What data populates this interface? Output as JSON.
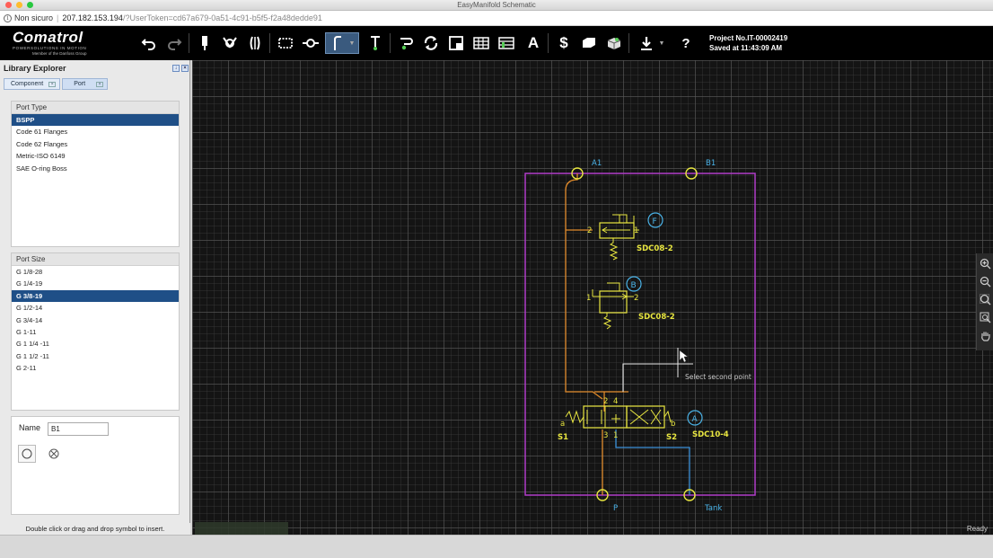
{
  "window": {
    "title": "EasyManifold Schematic"
  },
  "browser": {
    "security": "Non sicuro",
    "host": "207.182.153.194",
    "path": "/?UserToken=cd67a679-0a51-4c91-b5f5-f2a48dedde91"
  },
  "brand": {
    "name": "Comatrol",
    "tagline": "POWERSOLUTIONS IN MOTION",
    "subtitle": "Member of the Danfoss Group"
  },
  "project": {
    "number": "Project No.IT-00002419",
    "saved": "Saved at 11:43:09 AM"
  },
  "toolbar": {
    "text_tool": "A",
    "price_tool": "$",
    "help": "?"
  },
  "library": {
    "title": "Library Explorer",
    "tabs": [
      "Component",
      "Port"
    ],
    "port_type": {
      "header": "Port Type",
      "items": [
        "BSPP",
        "Code 61 Flanges",
        "Code 62 Flanges",
        "Metric-ISO 6149",
        "SAE O-ring Boss"
      ],
      "selected": "BSPP"
    },
    "port_size": {
      "header": "Port Size",
      "items": [
        "G 1/8-28",
        "G 1/4-19",
        "G 3/8-19",
        "G 1/2-14",
        "G 3/4-14",
        "G 1-11",
        "G 1 1/4 -11",
        "G 1 1/2 -11",
        "G 2-11"
      ],
      "selected": "G 3/8-19"
    },
    "name_label": "Name",
    "name_value": "B1",
    "status": "Double click or drag and drop symbol to insert."
  },
  "schematic": {
    "ports": {
      "a1": "A1",
      "b1": "B1",
      "p": "P",
      "tank": "Tank"
    },
    "valves": {
      "f": {
        "badge": "F",
        "model": "SDC08-2",
        "port_left": "2",
        "port_right": "1"
      },
      "b": {
        "badge": "B",
        "model": "SDC08-2",
        "port_left": "1",
        "port_right": "2"
      },
      "a": {
        "badge": "A",
        "model": "SDC10-4",
        "p2": "2",
        "p4": "4",
        "p3": "3",
        "p1": "1",
        "sol_a": "a",
        "sol_b": "b",
        "s1": "S1",
        "s2": "S2"
      }
    },
    "tooltip": "Select second point"
  },
  "status": {
    "ready": "Ready"
  },
  "colors": {
    "manifold": "#b03cc8",
    "pressure": "#e08a2a",
    "tank": "#3a8fd8",
    "valve": "#e8e640",
    "badge": "#4ab3e8"
  }
}
